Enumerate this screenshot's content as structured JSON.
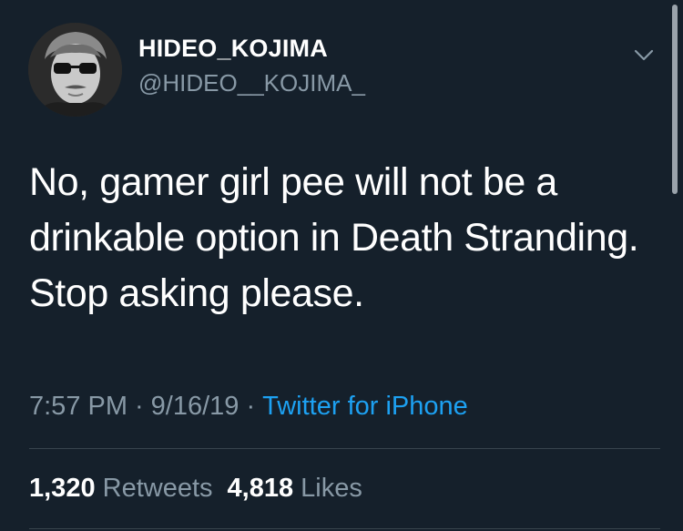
{
  "tweet": {
    "display_name": "HIDEO_KOJIMA",
    "handle": "@HIDEO__KOJIMA_",
    "text": "No, gamer girl pee will not be a drinkable option in Death Stranding. Stop asking please.",
    "time": "7:57 PM",
    "date": "9/16/19",
    "separator": "·",
    "source": "Twitter for iPhone",
    "retweets_count": "1,320",
    "retweets_label": "Retweets",
    "likes_count": "4,818",
    "likes_label": "Likes"
  },
  "icons": {
    "menu": "chevron-down-icon",
    "avatar": "profile-photo"
  },
  "colors": {
    "background": "#15202b",
    "primary_text": "#ffffff",
    "secondary_text": "#8899a6",
    "link": "#1da1f2",
    "divider": "#38444d"
  }
}
